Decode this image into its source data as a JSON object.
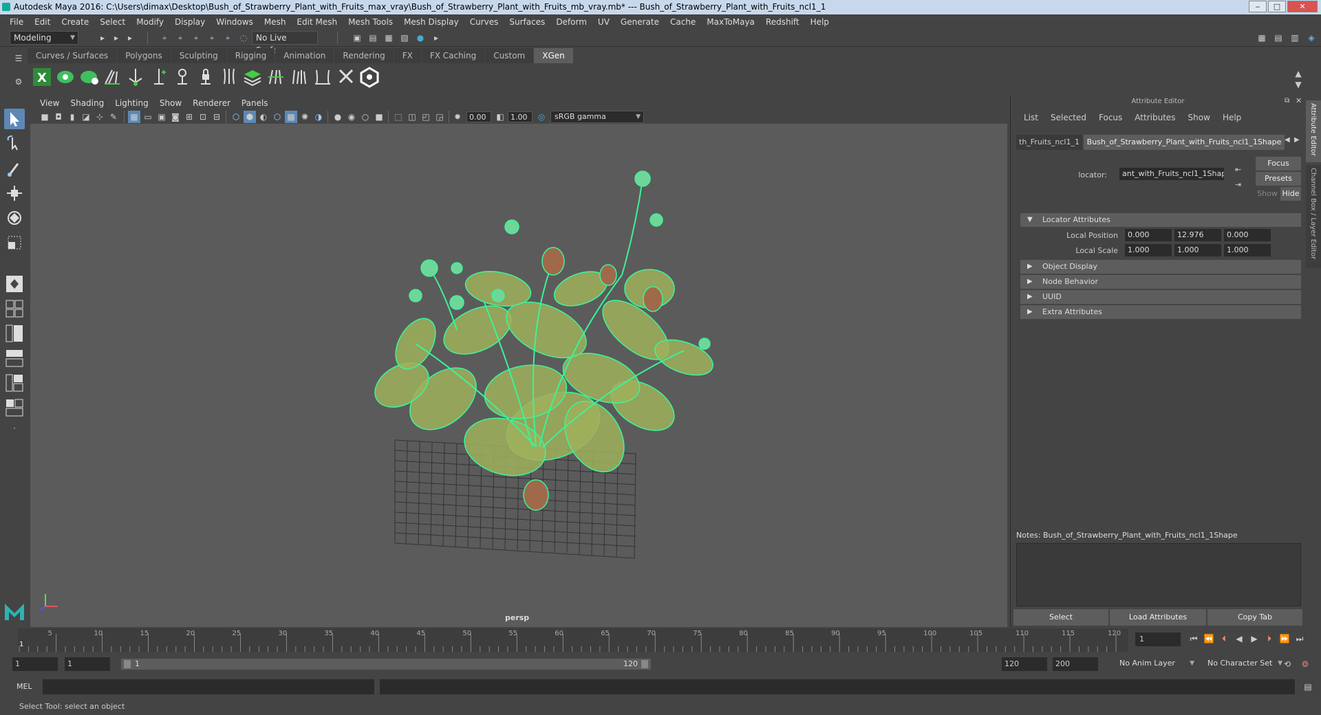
{
  "window": {
    "title": "Autodesk Maya 2016: C:\\Users\\dimax\\Desktop\\Bush_of_Strawberry_Plant_with_Fruits_max_vray\\Bush_of_Strawberry_Plant_with_Fruits_mb_vray.mb*   ---   Bush_of_Strawberry_Plant_with_Fruits_ncl1_1",
    "minimize": "‒",
    "maximize": "□",
    "close": "✕"
  },
  "menubar": [
    "File",
    "Edit",
    "Create",
    "Select",
    "Modify",
    "Display",
    "Windows",
    "Mesh",
    "Edit Mesh",
    "Mesh Tools",
    "Mesh Display",
    "Curves",
    "Surfaces",
    "Deform",
    "UV",
    "Generate",
    "Cache",
    "MaxToMaya",
    "Redshift",
    "Help"
  ],
  "statusline": {
    "mode": "Modeling",
    "live_surface": "No Live Surface"
  },
  "shelf": {
    "tabs": [
      "Curves / Surfaces",
      "Polygons",
      "Sculpting",
      "Rigging",
      "Animation",
      "Rendering",
      "FX",
      "FX Caching",
      "Custom",
      "XGen"
    ],
    "active_tab": "XGen"
  },
  "viewport": {
    "menu": [
      "View",
      "Shading",
      "Lighting",
      "Show",
      "Renderer",
      "Panels"
    ],
    "exposure": "0.00",
    "gamma": "1.00",
    "color_space": "sRGB gamma",
    "camera_label": "persp"
  },
  "attribute_editor": {
    "title": "Attribute Editor",
    "menu": [
      "List",
      "Selected",
      "Focus",
      "Attributes",
      "Show",
      "Help"
    ],
    "tab_left": "th_Fruits_ncl1_1",
    "tab_active": "Bush_of_Strawberry_Plant_with_Fruits_ncl1_1Shape",
    "locator_label": "locator:",
    "locator_value": "ant_with_Fruits_ncl1_1Shape",
    "focus_btn": "Focus",
    "presets_btn": "Presets",
    "show_btn": "Show",
    "hide_btn": "Hide",
    "sections": {
      "locator": "Locator Attributes",
      "object_display": "Object Display",
      "node_behavior": "Node Behavior",
      "uuid": "UUID",
      "extra": "Extra Attributes"
    },
    "local_position_label": "Local Position",
    "local_position": [
      "0.000",
      "12.976",
      "0.000"
    ],
    "local_scale_label": "Local Scale",
    "local_scale": [
      "1.000",
      "1.000",
      "1.000"
    ],
    "notes_label": "Notes:  Bush_of_Strawberry_Plant_with_Fruits_ncl1_1Shape",
    "buttons": [
      "Select",
      "Load Attributes",
      "Copy Tab"
    ],
    "side_tabs": [
      "Attribute Editor",
      "Channel Box / Layer Editor"
    ]
  },
  "timeline": {
    "ticks": [
      "5",
      "10",
      "15",
      "20",
      "25",
      "30",
      "35",
      "40",
      "45",
      "50",
      "55",
      "60",
      "65",
      "70",
      "75",
      "80",
      "85",
      "90",
      "95",
      "100",
      "105",
      "110",
      "115",
      "120"
    ],
    "current_frame_marker": "1",
    "current_frame": "1"
  },
  "range": {
    "start": "1",
    "anim_start": "1",
    "range_start_label": "1",
    "range_end_label": "120",
    "anim_end": "120",
    "end": "200",
    "anim_layer": "No Anim Layer",
    "character_set": "No Character Set"
  },
  "cmdline": {
    "label": "MEL"
  },
  "helpline": "Select Tool: select an object",
  "colors": {
    "wire": "#3df29a",
    "leaf": "#9fb25a",
    "bg": "#5b5b5b"
  }
}
